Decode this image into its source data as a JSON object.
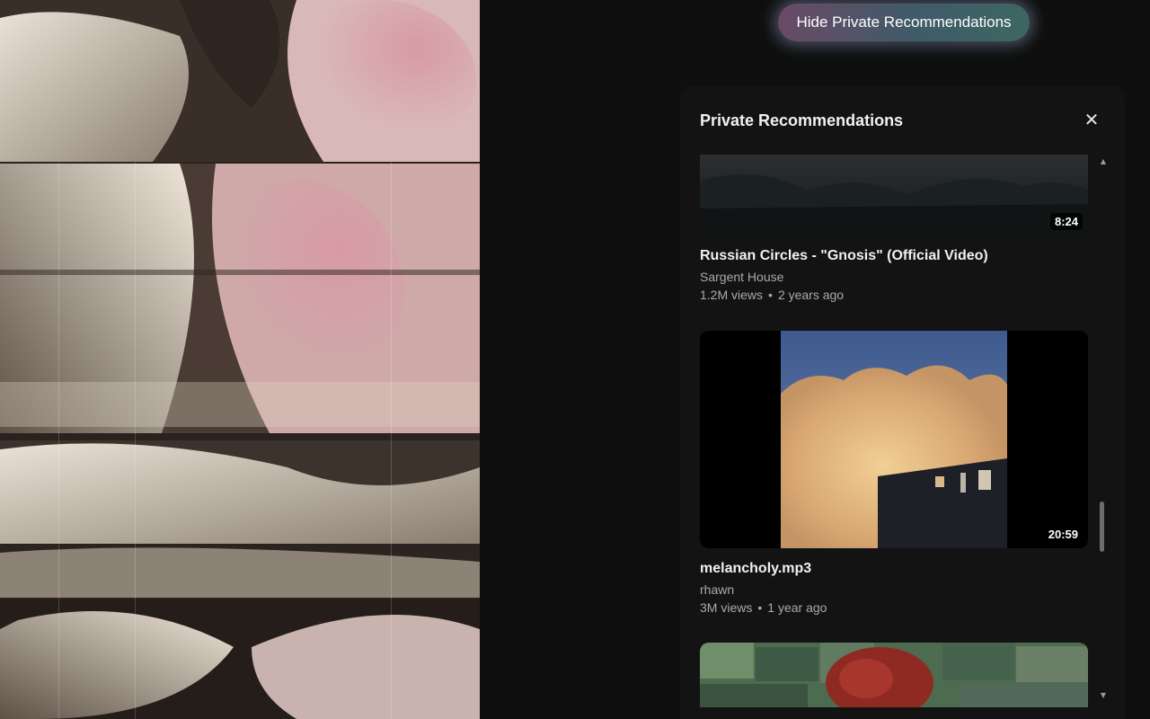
{
  "top_button": {
    "label": "Hide Private Recommendations"
  },
  "panel": {
    "title": "Private Recommendations",
    "close_icon": "close-icon",
    "videos": [
      {
        "title": "Russian Circles - \"Gnosis\" (Official Video)",
        "channel": "Sargent House",
        "views": "1.2M views",
        "age": "2 years ago",
        "duration": "8:24"
      },
      {
        "title": "melancholy.mp3",
        "channel": "rhawn",
        "views": "3M views",
        "age": "1 year ago",
        "duration": "20:59"
      },
      {
        "title": "",
        "channel": "",
        "views": "",
        "age": "",
        "duration": ""
      }
    ],
    "separator": "•"
  },
  "colors": {
    "background": "#0f0f0f",
    "panel": "#131313",
    "secondary_text": "#aaaaaa"
  }
}
